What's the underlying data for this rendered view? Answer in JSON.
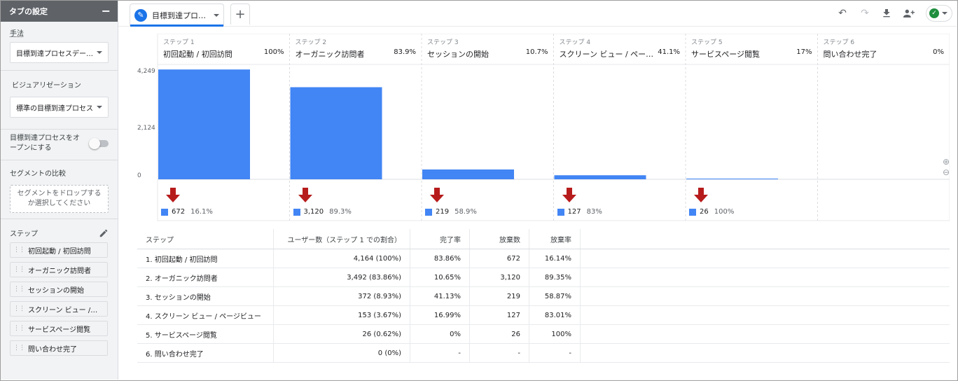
{
  "sidebar": {
    "title": "タブの設定",
    "collapse": "−",
    "technique_label": "手法",
    "technique_value": "目標到達プロセスデー…",
    "visualization_label": "ビジュアリゼーション",
    "visualization_value": "標準の目標到達プロセス",
    "open_funnel_label": "目標到達プロセスをオープンにする",
    "open_funnel_on": false,
    "segment_label": "セグメントの比較",
    "segment_drop_text": "セグメントをドロップするか選択してください",
    "steps_label": "ステップ",
    "steps": [
      "初回起動 / 初回訪問",
      "オーガニック訪問者",
      "セッションの開始",
      "スクリーン ビュー /…",
      "サービスページ閲覧",
      "問い合わせ完了"
    ]
  },
  "tab": {
    "title": "目標到達プロ…",
    "add": "+"
  },
  "colors": {
    "bar": "#4285f4",
    "arrow": "#b71c1c",
    "accent": "#1a73e8",
    "check": "#1e8e3e"
  },
  "chart_data": {
    "type": "bar",
    "yticks": [
      "4,249",
      "2,124",
      "0"
    ],
    "ylim": [
      0,
      4249
    ],
    "steps": [
      {
        "num": "ステップ 1",
        "name": "初回起動 / 初回訪問",
        "pct": "100%",
        "value": 4164,
        "drop_count": "672",
        "drop_pct": "16.1%"
      },
      {
        "num": "ステップ 2",
        "name": "オーガニック訪問者",
        "pct": "83.9%",
        "value": 3492,
        "drop_count": "3,120",
        "drop_pct": "89.3%"
      },
      {
        "num": "ステップ 3",
        "name": "セッションの開始",
        "pct": "10.7%",
        "value": 372,
        "drop_count": "219",
        "drop_pct": "58.9%"
      },
      {
        "num": "ステップ 4",
        "name": "スクリーン ビュー / ペー…",
        "pct": "41.1%",
        "value": 153,
        "drop_count": "127",
        "drop_pct": "83%"
      },
      {
        "num": "ステップ 5",
        "name": "サービスページ閲覧",
        "pct": "17%",
        "value": 26,
        "drop_count": "26",
        "drop_pct": "100%"
      },
      {
        "num": "ステップ 6",
        "name": "問い合わせ完了",
        "pct": "0%",
        "value": 0,
        "drop_count": "",
        "drop_pct": ""
      }
    ]
  },
  "table": {
    "headers": [
      "ステップ",
      "ユーザー数（ステップ 1 での割合）",
      "完了率",
      "放棄数",
      "放棄率"
    ],
    "rows": [
      [
        "1. 初回起動 / 初回訪問",
        "4,164 (100%)",
        "83.86%",
        "672",
        "16.14%"
      ],
      [
        "2. オーガニック訪問者",
        "3,492 (83.86%)",
        "10.65%",
        "3,120",
        "89.35%"
      ],
      [
        "3. セッションの開始",
        "372 (8.93%)",
        "41.13%",
        "219",
        "58.87%"
      ],
      [
        "4. スクリーン ビュー / ページビュー",
        "153 (3.67%)",
        "16.99%",
        "127",
        "83.01%"
      ],
      [
        "5. サービスページ閲覧",
        "26 (0.62%)",
        "0%",
        "26",
        "100%"
      ],
      [
        "6. 問い合わせ完了",
        "0 (0%)",
        "-",
        "-",
        "-"
      ]
    ]
  }
}
